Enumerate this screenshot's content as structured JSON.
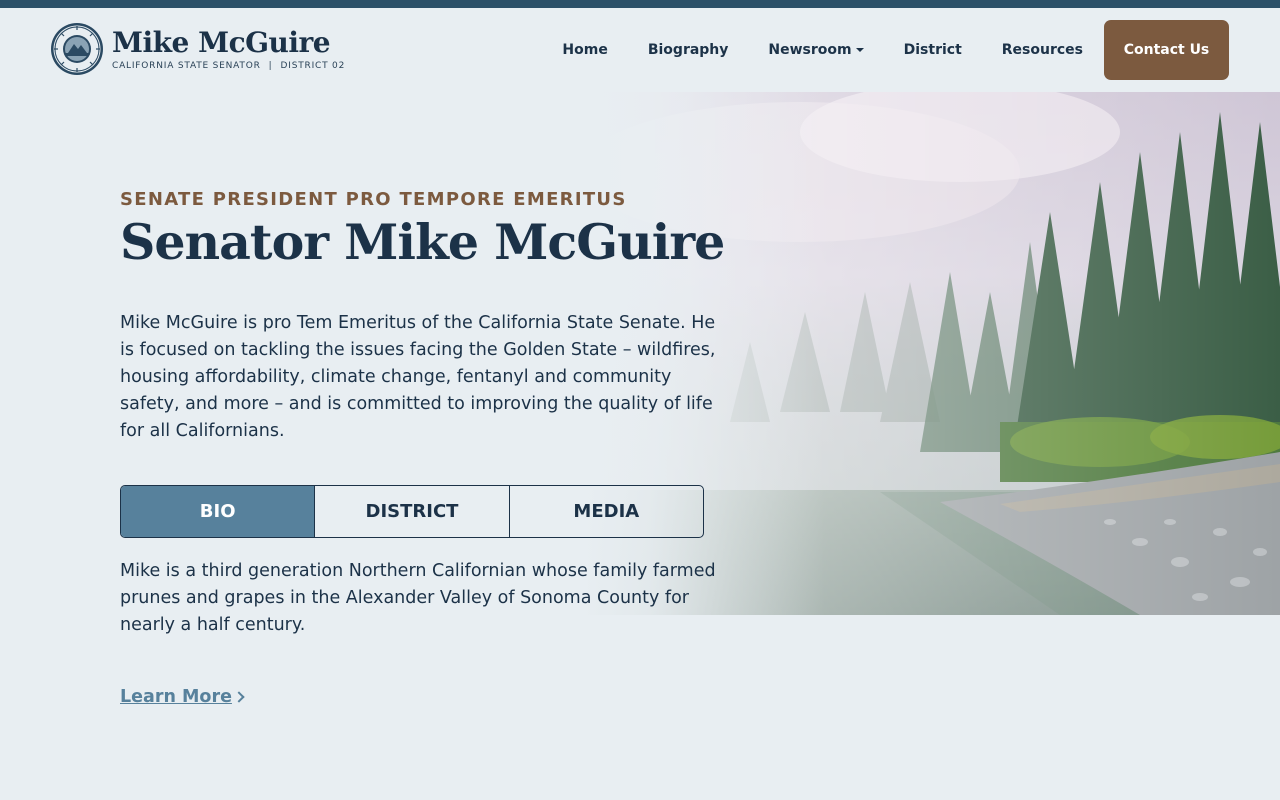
{
  "header": {
    "logo_name": "Mike McGuire",
    "logo_sub_left": "CALIFORNIA STATE SENATOR",
    "logo_sub_sep": "|",
    "logo_sub_right": "DISTRICT 02",
    "seal_icon": "state-senate-seal-icon"
  },
  "nav": {
    "items": [
      {
        "label": "Home"
      },
      {
        "label": "Biography"
      },
      {
        "label": "Newsroom",
        "has_dropdown": true
      },
      {
        "label": "District"
      },
      {
        "label": "Resources"
      }
    ],
    "contact_label": "Contact Us"
  },
  "hero": {
    "eyebrow": "SENATE PRESIDENT PRO TEMPORE EMERITUS",
    "title": "Senator Mike McGuire",
    "intro": "Mike McGuire is pro Tem Emeritus of the California State Senate. He is focused on tackling the issues facing the Golden State – wildfires, housing affordability, climate change, fentanyl and community safety, and more – and is committed to improving the quality of life for all Californians.",
    "image_icon": "misty-redwood-river-image"
  },
  "tabs": {
    "items": [
      {
        "label": "BIO",
        "active": true
      },
      {
        "label": "DISTRICT",
        "active": false
      },
      {
        "label": "MEDIA",
        "active": false
      }
    ]
  },
  "bio": {
    "text": "Mike is a third generation Northern Californian whose family farmed prunes and grapes in the Alexander Valley of Sonoma County for nearly a half century.",
    "learn_more": "Learn More"
  },
  "colors": {
    "navy": "#1c3248",
    "accent_brown": "#7c5a3f",
    "steel_blue": "#57819c",
    "background": "#e8eef2"
  }
}
